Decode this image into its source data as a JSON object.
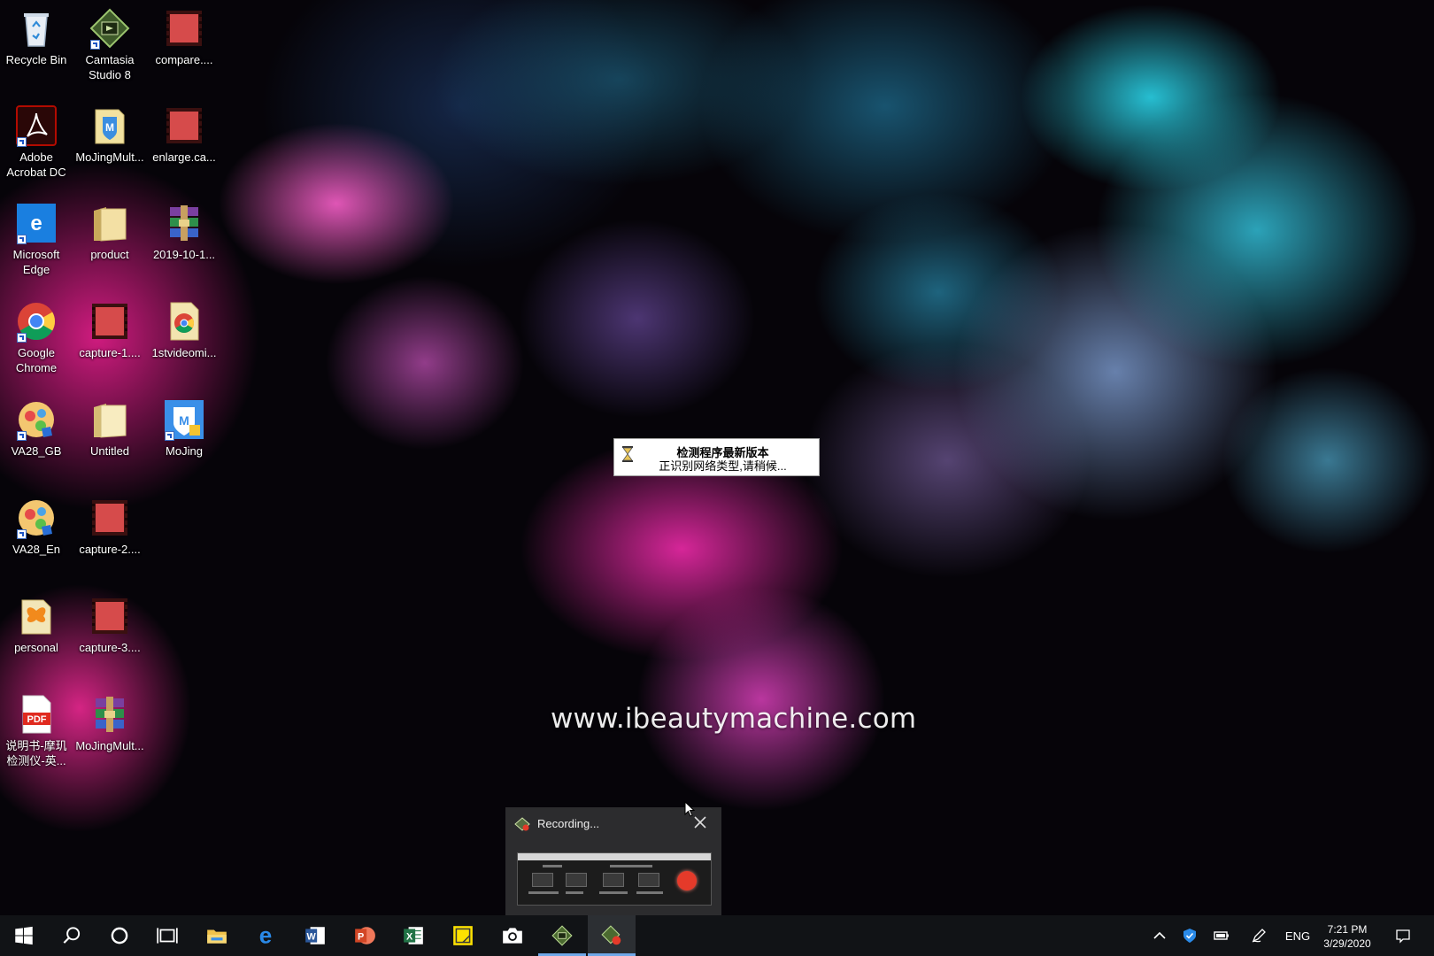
{
  "desktop": {
    "icons": [
      {
        "label": "Recycle Bin",
        "icon": "recycle-bin-icon"
      },
      {
        "label": "Camtasia Studio 8",
        "icon": "camtasia-icon"
      },
      {
        "label": "compare....",
        "icon": "video-file-icon"
      },
      {
        "label": "Adobe Acrobat DC",
        "icon": "acrobat-icon"
      },
      {
        "label": "MoJingMult...",
        "icon": "mojing-folder-icon"
      },
      {
        "label": "enlarge.ca...",
        "icon": "video-file-icon"
      },
      {
        "label": "Microsoft Edge",
        "icon": "edge-icon"
      },
      {
        "label": "product",
        "icon": "folder-icon"
      },
      {
        "label": "2019-10-1...",
        "icon": "winrar-icon"
      },
      {
        "label": "Google Chrome",
        "icon": "chrome-icon"
      },
      {
        "label": "capture-1....",
        "icon": "video-file-icon"
      },
      {
        "label": "1stvideomi...",
        "icon": "chrome-file-icon"
      },
      {
        "label": "VA28_GB",
        "icon": "va28-icon"
      },
      {
        "label": "Untitled",
        "icon": "folder-icon"
      },
      {
        "label": "MoJing",
        "icon": "mojing-icon"
      },
      {
        "label": "VA28_En",
        "icon": "va28-icon"
      },
      {
        "label": "capture-2....",
        "icon": "video-file-icon"
      },
      {
        "label": "personal",
        "icon": "butterfly-folder-icon"
      },
      {
        "label": "capture-3....",
        "icon": "video-file-icon"
      },
      {
        "label": "说明书-摩玑检测仪-英...",
        "icon": "pdf-icon"
      },
      {
        "label": "MoJingMult...",
        "icon": "winrar-icon"
      }
    ],
    "watermark": "www.ibeautymachine.com"
  },
  "dialog": {
    "title": "检测程序最新版本",
    "message": "正识别网络类型,请稍候..."
  },
  "recording_popup": {
    "title": "Recording..."
  },
  "taskbar": {
    "apps": [
      {
        "name": "start",
        "icon": "windows-start-icon"
      },
      {
        "name": "search",
        "icon": "search-icon"
      },
      {
        "name": "cortana",
        "icon": "cortana-circle-icon"
      },
      {
        "name": "task-view",
        "icon": "task-view-icon"
      },
      {
        "name": "file-explorer",
        "icon": "file-explorer-icon"
      },
      {
        "name": "edge",
        "icon": "edge-icon"
      },
      {
        "name": "word",
        "icon": "word-icon"
      },
      {
        "name": "powerpoint",
        "icon": "powerpoint-icon"
      },
      {
        "name": "excel",
        "icon": "excel-icon"
      },
      {
        "name": "sticky-notes",
        "icon": "sticky-notes-icon"
      },
      {
        "name": "camera",
        "icon": "camera-icon"
      },
      {
        "name": "camtasia",
        "icon": "camtasia-icon"
      },
      {
        "name": "camtasia-recorder",
        "icon": "camtasia-recorder-icon"
      }
    ],
    "tray": {
      "language": "ENG",
      "time": "7:21 PM",
      "date": "3/29/2020"
    }
  }
}
